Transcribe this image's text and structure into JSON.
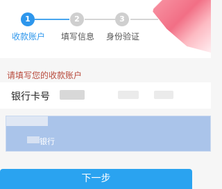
{
  "steps": [
    {
      "number": "1",
      "label": "收款账户",
      "active": true
    },
    {
      "number": "2",
      "label": "填写信息",
      "active": false
    },
    {
      "number": "3",
      "label": "身份验证",
      "active": false
    }
  ],
  "section_title": "请填写您的收款账户",
  "card_field": {
    "label": "银行卡号",
    "value": ""
  },
  "bank_panel": {
    "bank_name_suffix": "银行"
  },
  "next_button_label": "下一步",
  "colors": {
    "accent": "#2d96ec",
    "button": "#2aa3f0",
    "section_title": "#b84a3c"
  }
}
